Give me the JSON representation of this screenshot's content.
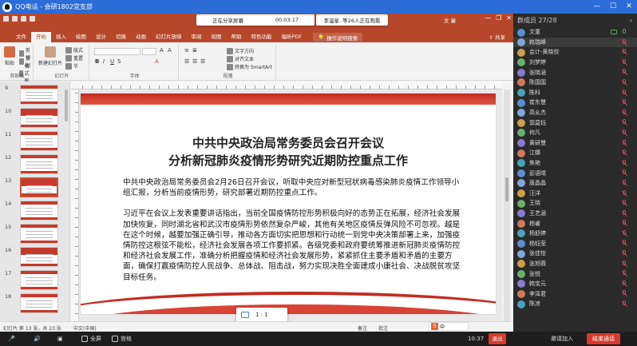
{
  "qq": {
    "window_title": "QQ电话 - 会研1802党支部"
  },
  "share_bar": {
    "label": "正在分享屏幕",
    "timer": "00:03:17",
    "notice": "李温星..等26人正在观看"
  },
  "ppt": {
    "user": "文 童",
    "tabs": [
      "文件",
      "开始",
      "插入",
      "绘图",
      "设计",
      "切换",
      "动画",
      "幻灯片放映",
      "审阅",
      "视图",
      "帮助",
      "特色功能",
      "福昕PDF"
    ],
    "active_tab": "开始",
    "search_label": "操作说明搜索",
    "share_label": "共享",
    "ribbon_groups": [
      "剪贴板",
      "幻灯片",
      "字体",
      "段落"
    ],
    "ribbon_buttons": {
      "paste": "粘贴",
      "cut": "剪切",
      "copy": "复制",
      "format_painter": "格式刷",
      "new_slide": "新建幻灯片",
      "layout": "版式",
      "reset": "重置",
      "section": "节",
      "text_direction": "文字方向",
      "align_text": "对齐文本",
      "smartart": "转换为 SmartArt"
    },
    "thumbnail_numbers": [
      "9",
      "10",
      "11",
      "12",
      "13",
      "14",
      "15",
      "16",
      "17",
      "18"
    ],
    "selected_thumbnail": "13",
    "status": {
      "slide_info": "幻灯片 第 13 张，共 23 张",
      "language": "中文(中国)",
      "notes": "备注",
      "comments": "批注"
    },
    "zoom_toast": "1 : 1",
    "ime_label": "中"
  },
  "slide": {
    "title_line1": "中共中央政治局常务委员会召开会议",
    "title_line2": "分析新冠肺炎疫情形势研究近期防控重点工作",
    "para1": "中共中央政治局常务委员会2月26日召开会议，听取中央应对新型冠状病毒感染肺炎疫情工作领导小组汇报，分析当前疫情形势，研究部署近期防控重点工作。",
    "para2": "习近平在会议上发表重要讲话指出，当前全国疫情防控形势积极向好的态势正在拓展，经济社会发展加快恢复，同时湖北省和武汉市疫情形势依然复杂严峻，其他有关地区疫情反弹风险不可忽视。越是在这个时候，越要加强正确引导，推动各方面切实把思想和行动统一到党中央决策部署上来，加强疫情防控这根弦不能松，经济社会发展各项工作要抓紧。各级党委和政府要统筹推进新冠肺炎疫情防控和经济社会发展工作，准确分析把握疫情和经济社会发展形势，紧紧抓住主要矛盾和矛盾的主要方面，确保打赢疫情防控人民战争、总体战、阻击战，努力实现决胜全面建成小康社会、决战脱贫攻坚目标任务。"
  },
  "members_panel": {
    "header": "群成员 27/28",
    "members": [
      {
        "name": "文童",
        "mic": "on",
        "camera": true
      },
      {
        "name": "韩瑞峰",
        "mic": "off",
        "active": true
      },
      {
        "name": "会计-黄晓佼",
        "mic": "off"
      },
      {
        "name": "刘梦婷",
        "mic": "off"
      },
      {
        "name": "张晓涵",
        "mic": "off"
      },
      {
        "name": "陈国国",
        "mic": "off"
      },
      {
        "name": "陈科",
        "mic": "off"
      },
      {
        "name": "崔东慧",
        "mic": "off"
      },
      {
        "name": "高幺杰",
        "mic": "off"
      },
      {
        "name": "郭莫钰",
        "mic": "off"
      },
      {
        "name": "何凡",
        "mic": "off"
      },
      {
        "name": "黄研慧",
        "mic": "off"
      },
      {
        "name": "江娜",
        "mic": "off"
      },
      {
        "name": "焦艳",
        "mic": "off"
      },
      {
        "name": "彭语晴",
        "mic": "off"
      },
      {
        "name": "唐晶晶",
        "mic": "off"
      },
      {
        "name": "汪洋",
        "mic": "off"
      },
      {
        "name": "王晓",
        "mic": "off"
      },
      {
        "name": "王艺涵",
        "mic": "off"
      },
      {
        "name": "杨睿",
        "mic": "off"
      },
      {
        "name": "杨舒婷",
        "mic": "off"
      },
      {
        "name": "杨钰莹",
        "mic": "off"
      },
      {
        "name": "张佳怡",
        "mic": "off"
      },
      {
        "name": "张旭薇",
        "mic": "off"
      },
      {
        "name": "张悦",
        "mic": "off"
      },
      {
        "name": "韩宝元",
        "mic": "off"
      },
      {
        "name": "李泽君",
        "mic": "off"
      },
      {
        "name": "陈凉",
        "mic": "off"
      }
    ]
  },
  "bottom_bar": {
    "fullscreen": "全屏",
    "layout": "宫格",
    "time": "10:37",
    "exit": "退出",
    "end_call": "结束通话",
    "invite": "邀请加入"
  },
  "colors": {
    "qq_blue": "#2b6cd6",
    "ppt_red": "#b7472a",
    "slide_red": "#c22d1f",
    "end_red": "#d93a2b"
  }
}
